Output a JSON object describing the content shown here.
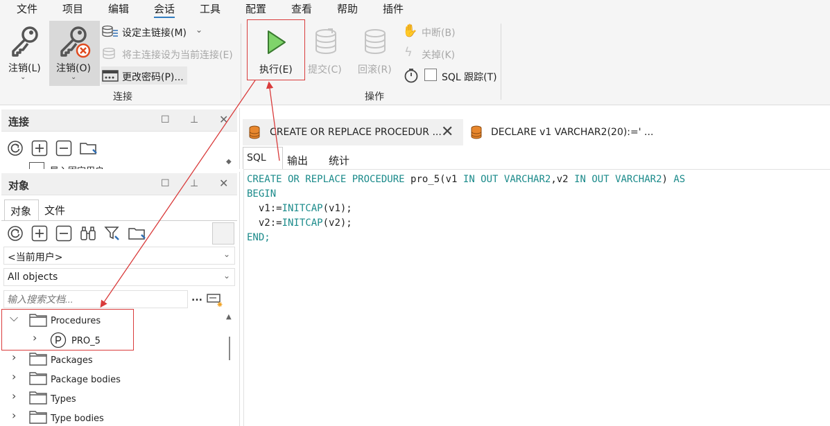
{
  "menu": [
    "文件",
    "项目",
    "编辑",
    "会话",
    "工具",
    "配置",
    "查看",
    "帮助",
    "插件"
  ],
  "menu_active": "会话",
  "ribbon": {
    "logout1": "注销(L)",
    "logout2": "注销(O)",
    "set_main": "设定主链接(M)",
    "set_current": "将主连接设为当前连接(E)",
    "change_pwd": "更改密码(P)...",
    "group_connect": "连接",
    "execute": "执行(E)",
    "commit": "提交(C)",
    "rollback": "回滚(R)",
    "break": "中断(B)",
    "close": "关掉(K)",
    "sql_trace": "SQL 跟踪(T)",
    "group_ops": "操作"
  },
  "connect_panel": {
    "title": "连接",
    "partial_item": "导入固定用户"
  },
  "object_panel": {
    "title": "对象",
    "tabs": [
      "对象",
      "文件"
    ],
    "user_select": "<当前用户>",
    "type_select": "All objects",
    "search_placeholder": "输入搜索文档...",
    "more": "..."
  },
  "tree": [
    {
      "label": "Procedures",
      "expanded": true
    },
    {
      "label": "PRO_5",
      "child": true
    },
    {
      "label": "Packages"
    },
    {
      "label": "Package bodies"
    },
    {
      "label": "Types"
    },
    {
      "label": "Type bodies"
    }
  ],
  "doc_tabs": [
    "CREATE OR REPLACE PROCEDUR ...",
    "DECLARE v1 VARCHAR2(20):=' ..."
  ],
  "sub_tabs": [
    "SQL",
    "输出",
    "统计"
  ],
  "code_lines": [
    "CREATE OR REPLACE PROCEDURE pro_5(v1 IN OUT VARCHAR2,v2 IN OUT VARCHAR2) AS",
    "BEGIN",
    "  v1:=INITCAP(v1);",
    "  v2:=INITCAP(v2);",
    "END;"
  ]
}
